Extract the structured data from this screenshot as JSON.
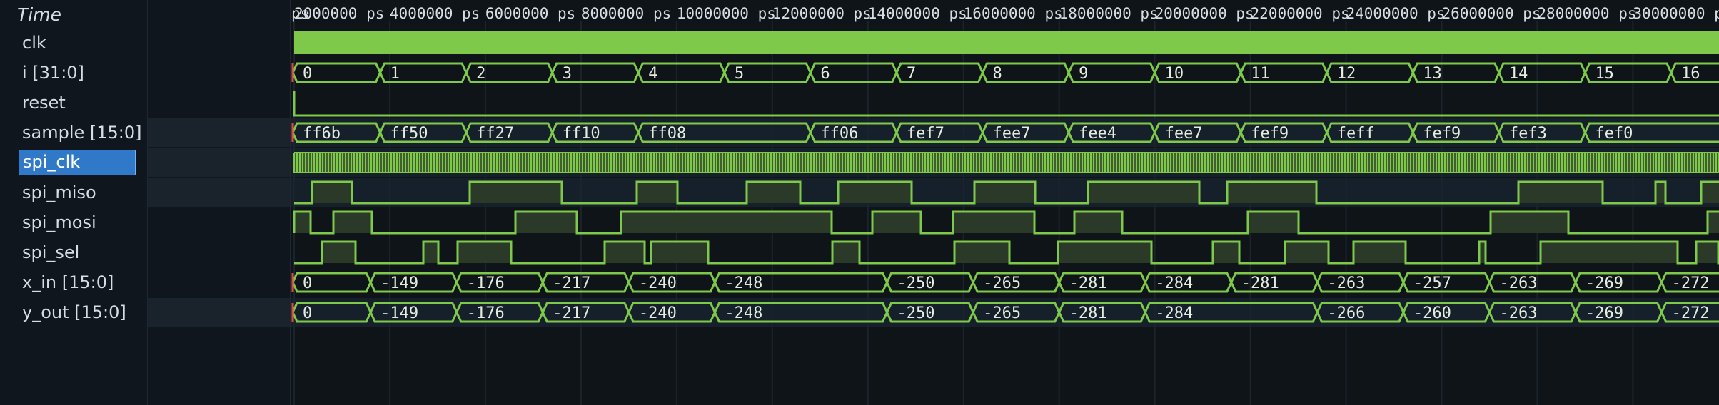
{
  "time_header": "Time",
  "time_axis": {
    "unit": "ps",
    "tick_step": 2000000,
    "ticks": [
      "ps",
      "2000000 ps",
      "4000000 ps",
      "6000000 ps",
      "8000000 ps",
      "10000000 ps",
      "12000000 ps",
      "14000000 ps",
      "16000000 ps",
      "18000000 ps",
      "20000000 ps",
      "22000000 ps",
      "24000000 ps",
      "26000000 ps",
      "28000000 ps",
      "30000000 ps"
    ]
  },
  "colors": {
    "wave": "#7ec84a",
    "fill": "#2b3a28",
    "text": "#e6ece0",
    "tick": "#1b242c"
  },
  "signals": [
    {
      "name": "clk",
      "kind": "clock"
    },
    {
      "name": "i [31:0]",
      "kind": "bus",
      "segments": [
        [
          0,
          "0"
        ],
        [
          1800000,
          "1"
        ],
        [
          3600000,
          "2"
        ],
        [
          5400000,
          "3"
        ],
        [
          7200000,
          "4"
        ],
        [
          9000000,
          "5"
        ],
        [
          10800000,
          "6"
        ],
        [
          12600000,
          "7"
        ],
        [
          14400000,
          "8"
        ],
        [
          16200000,
          "9"
        ],
        [
          18000000,
          "10"
        ],
        [
          19800000,
          "11"
        ],
        [
          21600000,
          "12"
        ],
        [
          23400000,
          "13"
        ],
        [
          25200000,
          "14"
        ],
        [
          27000000,
          "15"
        ],
        [
          28800000,
          "16"
        ]
      ]
    },
    {
      "name": "reset",
      "kind": "reset"
    },
    {
      "name": "sample [15:0]",
      "kind": "bus",
      "highlight": true,
      "segments": [
        [
          0,
          "ff6b"
        ],
        [
          1800000,
          "ff50"
        ],
        [
          3600000,
          "ff27"
        ],
        [
          5400000,
          "ff10"
        ],
        [
          7200000,
          "ff08"
        ],
        [
          10800000,
          "ff06"
        ],
        [
          12600000,
          "fef7"
        ],
        [
          14400000,
          "fee7"
        ],
        [
          16200000,
          "fee4"
        ],
        [
          18000000,
          "fee7"
        ],
        [
          19800000,
          "fef9"
        ],
        [
          21600000,
          "feff"
        ],
        [
          23400000,
          "fef9"
        ],
        [
          25200000,
          "fef3"
        ],
        [
          27000000,
          "fef0"
        ]
      ]
    },
    {
      "name": "spi_clk",
      "kind": "spiclk",
      "selected": true,
      "highlight": true
    },
    {
      "name": "spi_miso",
      "kind": "bit",
      "highlight": true
    },
    {
      "name": "spi_mosi",
      "kind": "bit"
    },
    {
      "name": "spi_sel",
      "kind": "bit"
    },
    {
      "name": "x_in [15:0]",
      "kind": "bus",
      "segments": [
        [
          0,
          "0"
        ],
        [
          1600000,
          "-149"
        ],
        [
          3400000,
          "-176"
        ],
        [
          5200000,
          "-217"
        ],
        [
          7000000,
          "-240"
        ],
        [
          8800000,
          "-248"
        ],
        [
          12400000,
          "-250"
        ],
        [
          14200000,
          "-265"
        ],
        [
          16000000,
          "-281"
        ],
        [
          17800000,
          "-284"
        ],
        [
          19600000,
          "-281"
        ],
        [
          21400000,
          "-263"
        ],
        [
          23200000,
          "-257"
        ],
        [
          25000000,
          "-263"
        ],
        [
          26800000,
          "-269"
        ],
        [
          28600000,
          "-272"
        ]
      ]
    },
    {
      "name": "y_out [15:0]",
      "kind": "bus",
      "highlight": true,
      "segments": [
        [
          0,
          "0"
        ],
        [
          1600000,
          "-149"
        ],
        [
          3400000,
          "-176"
        ],
        [
          5200000,
          "-217"
        ],
        [
          7000000,
          "-240"
        ],
        [
          8800000,
          "-248"
        ],
        [
          12400000,
          "-250"
        ],
        [
          14200000,
          "-265"
        ],
        [
          16000000,
          "-281"
        ],
        [
          17800000,
          "-284"
        ],
        [
          21400000,
          "-266"
        ],
        [
          23200000,
          "-260"
        ],
        [
          25000000,
          "-263"
        ],
        [
          26800000,
          "-269"
        ],
        [
          28600000,
          "-272"
        ]
      ]
    }
  ]
}
